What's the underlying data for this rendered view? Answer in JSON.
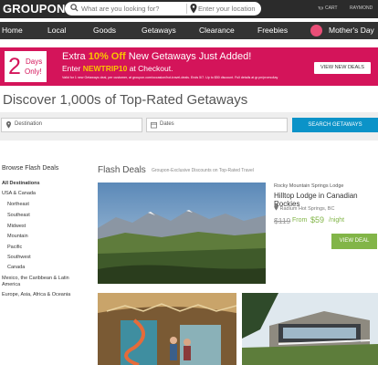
{
  "brand": "GROUPON",
  "search": {
    "placeholder": "What are you looking for?",
    "location_placeholder": "Enter your location"
  },
  "cart_label": "CART",
  "user_label": "RAYMOND",
  "nav": [
    "Home",
    "Local",
    "Goods",
    "Getaways",
    "Clearance",
    "Freebies",
    "Mother's Day"
  ],
  "promo": {
    "days_number": "2",
    "days_word": "Days",
    "only_word": "Only!",
    "line1_pre": "Extra ",
    "line1_highlight": "10% Off",
    "line1_post": " New Getaways Just Added!",
    "line2_pre": "Enter ",
    "line2_code": "NEWTRIP10",
    "line2_post": " at Checkout.",
    "fine_print": "Valid for 1 new Getaways deal, per customer, at groupon.com/occasion/hot-travel-deals. Ends 5/7. Up to $50 discount. Full details at gr.pn/promo4ay",
    "button": "VIEW NEW DEALS"
  },
  "headline": "Discover 1,000s of Top-Rated Getaways",
  "filters": {
    "destination": "Destination",
    "dates": "Dates",
    "search_button": "SEARCH GETAWAYS"
  },
  "sidebar": {
    "title": "Browse Flash Deals",
    "items": [
      "All Destinations",
      "USA & Canada",
      "Northeast",
      "Southeast",
      "Midwest",
      "Mountain",
      "Pacific",
      "Southwest",
      "Canada",
      "Mexico, the Caribbean & Latin America",
      "Europe, Asia, Africa & Oceania"
    ]
  },
  "main": {
    "heading": "Flash Deals",
    "subheading": "Groupon-Exclusive Discounts on Top-Rated Travel",
    "deal": {
      "brand": "Rocky Mountain Springs Lodge",
      "title": "Hilltop Lodge in Canadian Rockies",
      "location": "Radium Hot Springs, BC",
      "old_price": "$119",
      "from": "From",
      "new_price": "$59",
      "per": "/night",
      "button": "VIEW DEAL"
    }
  },
  "colors": {
    "promo_bg": "#d4145a",
    "accent_green": "#82b548",
    "search_blue": "#0b93c8",
    "topbar": "#2b2b2b"
  }
}
